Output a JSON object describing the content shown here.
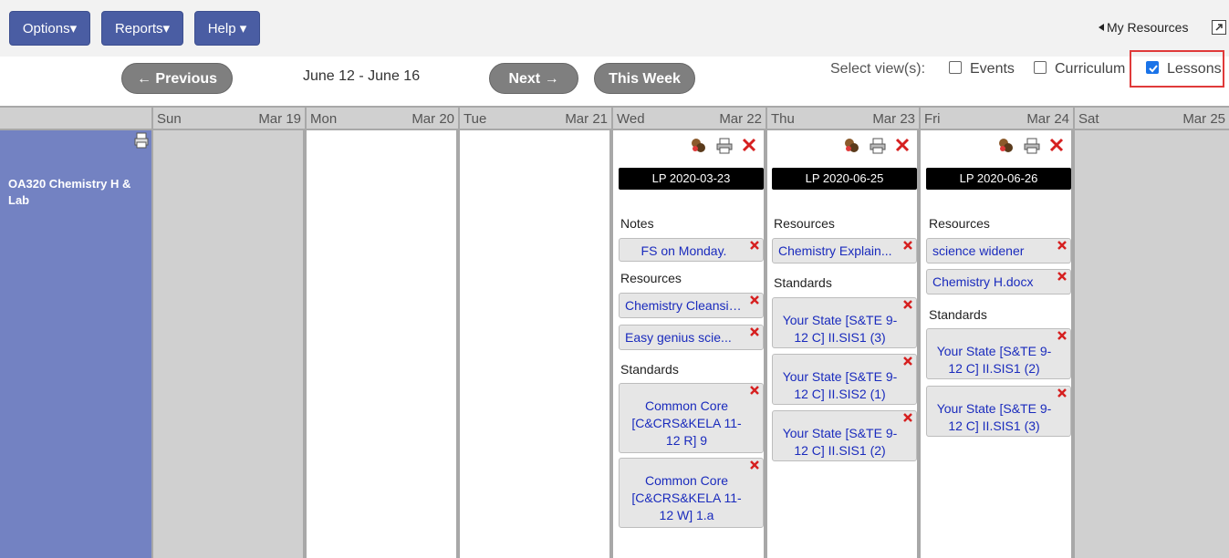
{
  "menu": {
    "options": "Options▾",
    "reports": "Reports▾",
    "help": "Help ▾",
    "my_resources": "My Resources",
    "expand_icon": "expand-icon"
  },
  "nav": {
    "previous": "← Previous",
    "date_range": "June 12 - June 16",
    "next": "Next →",
    "this_week": "This Week",
    "select_views_label": "Select view(s):",
    "views": [
      {
        "label": "Events",
        "checked": false
      },
      {
        "label": "Curriculum",
        "checked": false
      },
      {
        "label": "Lessons",
        "checked": true
      }
    ],
    "highlight_color": "#e03a3a"
  },
  "days": [
    {
      "day": "Sun",
      "date": "Mar 19"
    },
    {
      "day": "Mon",
      "date": "Mar 20"
    },
    {
      "day": "Tue",
      "date": "Mar 21"
    },
    {
      "day": "Wed",
      "date": "Mar 22"
    },
    {
      "day": "Thu",
      "date": "Mar 23"
    },
    {
      "day": "Fri",
      "date": "Mar 24"
    },
    {
      "day": "Sat",
      "date": "Mar 25"
    }
  ],
  "course": {
    "name": "OA320 Chemistry H & Lab",
    "color": "#7382c2"
  },
  "lessons": {
    "wed": {
      "title": "LP 2020-03-23",
      "notes_heading": "Notes",
      "notes": [
        "FS on Monday."
      ],
      "resources_heading": "Resources",
      "resources": [
        "Chemistry Cleansing...",
        "Easy genius scie..."
      ],
      "standards_heading": "Standards",
      "standards": [
        "Common Core [C&CRS&KELA 11-12 R] 9",
        "Common Core [C&CRS&KELA 11-12 W] 1.a"
      ]
    },
    "thu": {
      "title": "LP 2020-06-25",
      "resources_heading": "Resources",
      "resources": [
        "Chemistry Explain..."
      ],
      "standards_heading": "Standards",
      "standards": [
        "Your State [S&TE 9-12 C] II.SIS1 (3)",
        "Your State [S&TE 9-12 C] II.SIS2 (1)",
        "Your State [S&TE 9-12 C] II.SIS1 (2)"
      ]
    },
    "fri": {
      "title": "LP 2020-06-26",
      "resources_heading": "Resources",
      "resources": [
        "science widener",
        "Chemistry H.docx"
      ],
      "standards_heading": "Standards",
      "standards": [
        "Your State [S&TE 9-12 C] II.SIS1 (2)",
        "Your State [S&TE 9-12 C] II.SIS1 (3)"
      ]
    }
  },
  "colors": {
    "menu_button": "#4a5da3",
    "pill_button": "#7f7f7f",
    "item_text": "#1a2bbd",
    "delete_x": "#d62020",
    "weekend_bg": "#d0d0d0"
  }
}
